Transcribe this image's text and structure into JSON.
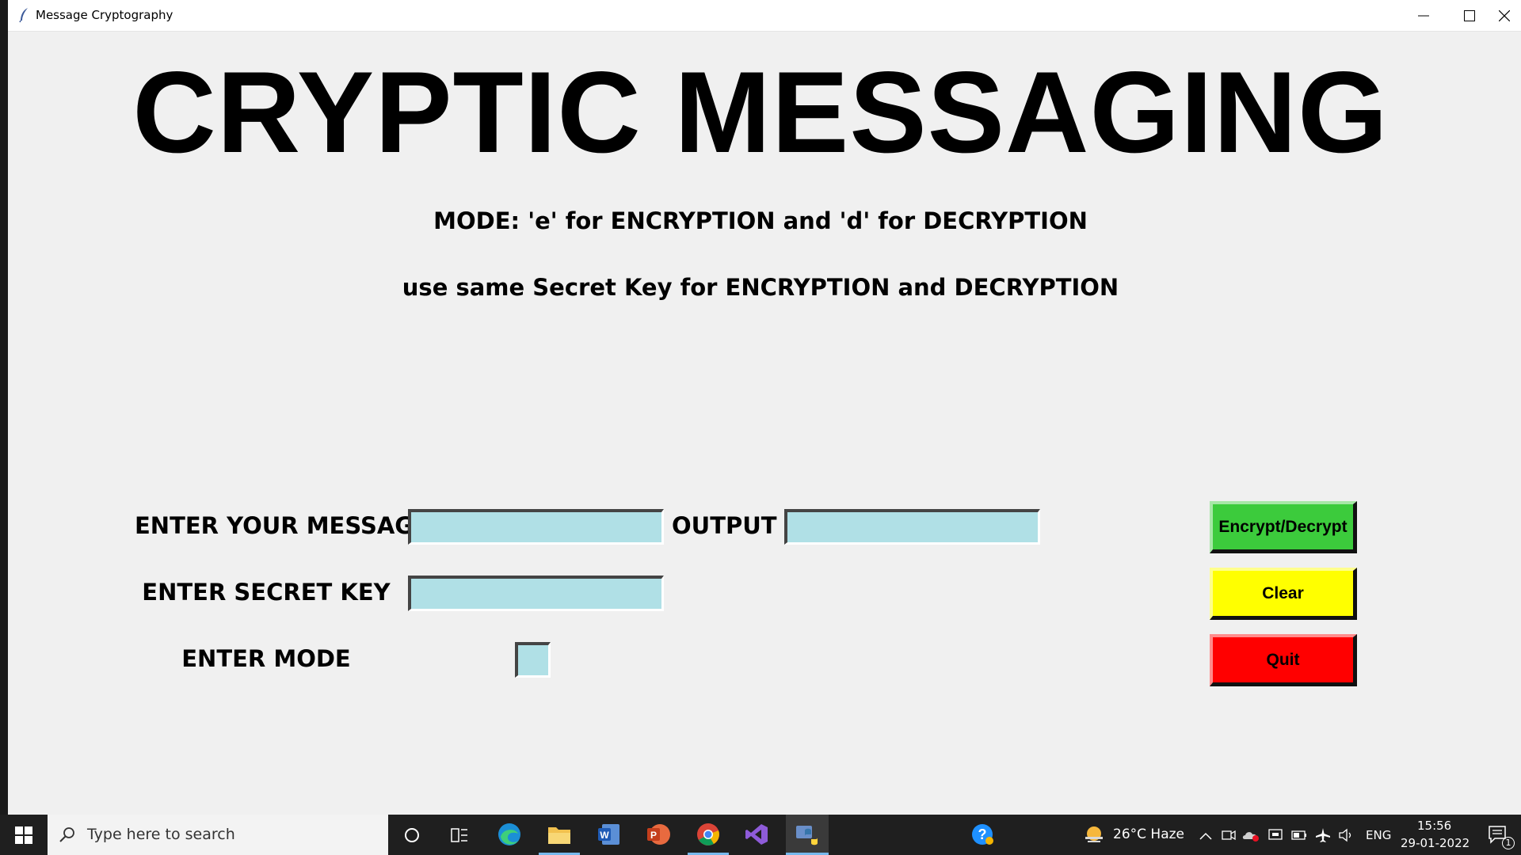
{
  "window": {
    "title": "Message Cryptography"
  },
  "main": {
    "heading": "CRYPTIC MESSAGING",
    "mode_hint": "MODE: 'e' for ENCRYPTION and 'd' for DECRYPTION",
    "key_hint": "use same Secret Key for ENCRYPTION and DECRYPTION",
    "message_label": "ENTER YOUR MESSAGE",
    "message_value": "",
    "output_label": "OUTPUT",
    "output_value": "",
    "key_label": "ENTER SECRET KEY",
    "key_value": "",
    "mode_label": "ENTER MODE",
    "mode_value": ""
  },
  "buttons": {
    "encrypt_decrypt": "Encrypt/Decrypt",
    "clear": "Clear",
    "quit": "Quit"
  },
  "colors": {
    "entry_bg": "#b0e0e6",
    "encrypt_button": "#3ccb3c",
    "clear_button": "#ffff00",
    "quit_button": "#ff0000",
    "window_bg": "#f0f0f0"
  },
  "taskbar": {
    "search_placeholder": "Type here to search",
    "weather": "26°C  Haze",
    "language": "ENG",
    "time": "15:56",
    "date": "29-01-2022",
    "notification_count": "1",
    "pinned_apps": [
      "task-view",
      "edge",
      "file-explorer",
      "word",
      "powerpoint",
      "chrome",
      "visual-studio",
      "python"
    ]
  }
}
